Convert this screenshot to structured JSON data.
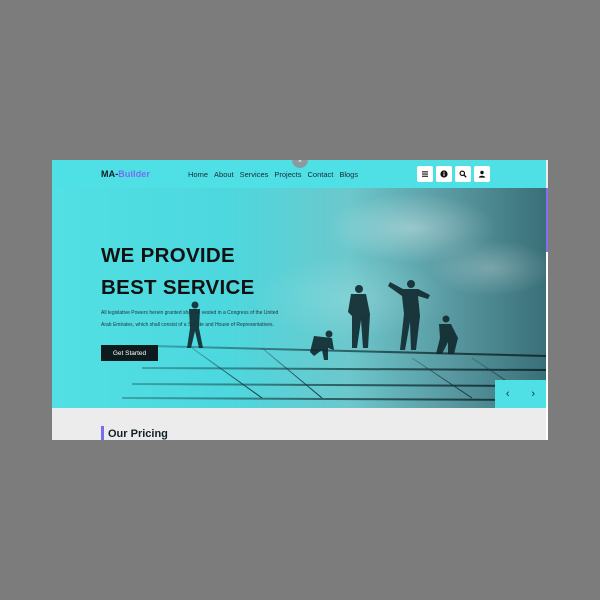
{
  "brand": {
    "prefix": "MA-",
    "suffix": "Builder",
    "accent": "#7a6cf0"
  },
  "nav": {
    "links": [
      "Home",
      "About",
      "Services",
      "Projects",
      "Contact",
      "Blogs"
    ],
    "close_symbol": "×",
    "icons": [
      "menu-icon",
      "info-icon",
      "search-icon",
      "user-icon"
    ]
  },
  "hero": {
    "title_line1": "WE PROVIDE",
    "title_line2": "BEST SERVICE",
    "description": "All legislative Powers herein granted shall be vested in a Congress of the United Arab Emirates, which shall consist of a Senate and House of Representatives.",
    "cta_label": "Get Started",
    "prev_symbol": "‹",
    "next_symbol": "›"
  },
  "pricing": {
    "title": "Our Pricing"
  },
  "colors": {
    "primary": "#4fe0e6",
    "accent": "#7a6cf0",
    "dark": "#0d1a1e",
    "background": "#7c7c7c"
  }
}
